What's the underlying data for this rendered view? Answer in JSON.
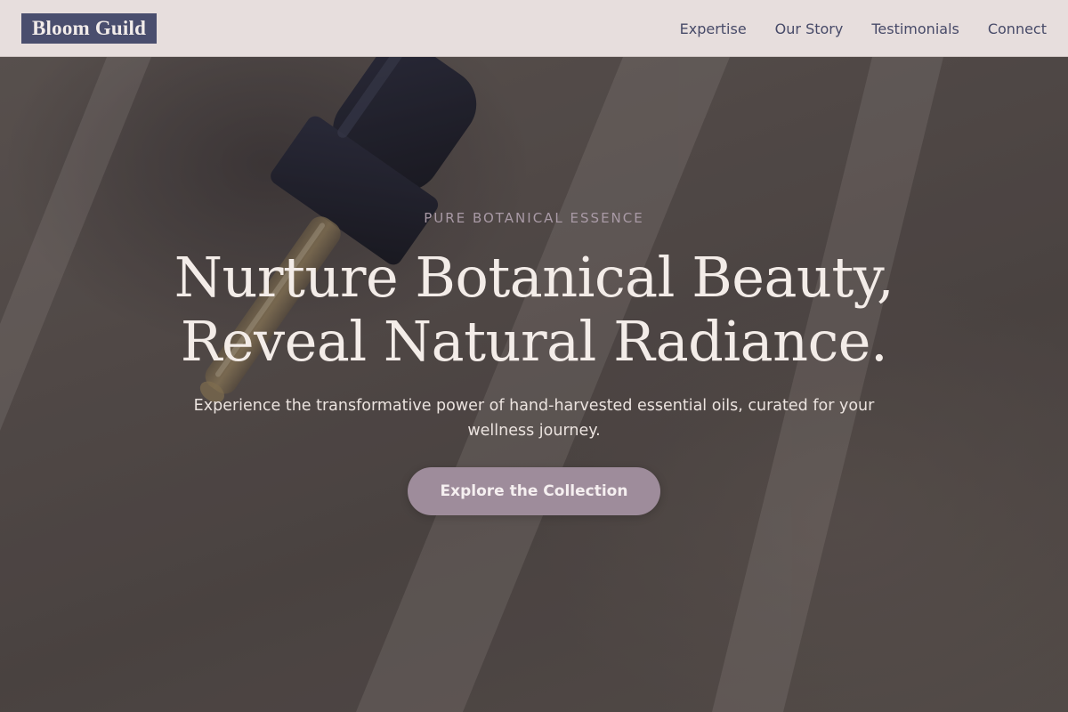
{
  "header": {
    "logo": "Bloom Guild",
    "nav": [
      {
        "label": "Expertise"
      },
      {
        "label": "Our Story"
      },
      {
        "label": "Testimonials"
      },
      {
        "label": "Connect"
      }
    ]
  },
  "hero": {
    "background_image": "dropper-bottle-on-stone-photo",
    "eyebrow": "PURE BOTANICAL ESSENCE",
    "headline_line1": "Nurture Botanical Beauty,",
    "headline_line2": "Reveal Natural Radiance.",
    "subtext": "Experience the transformative power of hand-harvested essential oils, curated for your wellness journey.",
    "cta_label": "Explore the Collection"
  },
  "colors": {
    "header_bg": "#e7dedd",
    "logo_bg": "#4a4e6e",
    "nav_text": "#474a68",
    "cta_bg": "#9e8c9b",
    "headline_text": "#f3ece8",
    "eyebrow_text": "#a99aa6"
  }
}
